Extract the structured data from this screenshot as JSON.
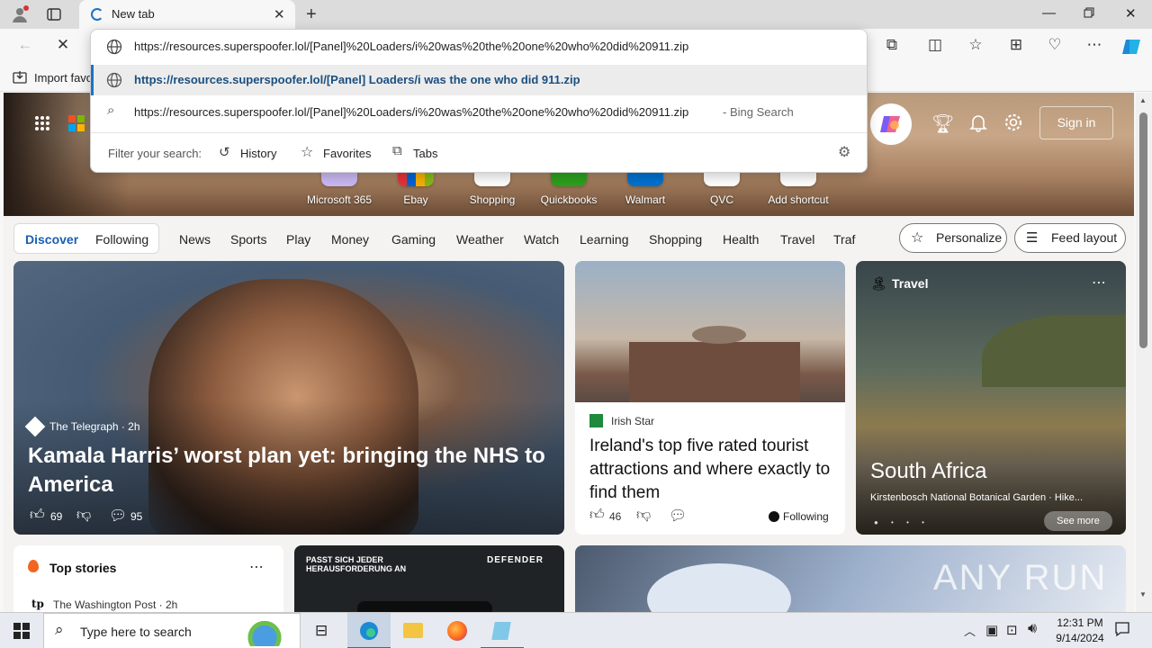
{
  "browser": {
    "tab_title": "New tab",
    "address_value": "https://resources.superspoofer.lol/[Panel]%20Loaders/i%20was%20the%20one%20who%20did%20911.zip",
    "favorites_bar": {
      "import_label": "Import favo"
    }
  },
  "dropdown": {
    "suggestion_url": "https://resources.superspoofer.lol/[Panel] Loaders/i was the one who did 911.zip",
    "search_text": "https://resources.superspoofer.lol/[Panel]%20Loaders/i%20was%20the%20one%20who%20did%20911.zip",
    "search_suffix": "- Bing Search",
    "filter_label": "Filter your search:",
    "filters": [
      "History",
      "Favorites",
      "Tabs"
    ]
  },
  "page": {
    "sign_in": "Sign in",
    "shortcuts": [
      "Microsoft 365",
      "Ebay",
      "Shopping",
      "Quickbooks",
      "Walmart",
      "QVC",
      "Add shortcut"
    ],
    "nav": {
      "discover": "Discover",
      "following": "Following",
      "items": [
        "News",
        "Sports",
        "Play",
        "Money",
        "Gaming",
        "Weather",
        "Watch",
        "Learning",
        "Shopping",
        "Health",
        "Travel",
        "Traf"
      ],
      "personalize": "Personalize",
      "feed_layout": "Feed layout"
    },
    "main_card": {
      "source": "The Telegraph · 2h",
      "headline": "Kamala Harris’ worst plan yet: bringing the NHS to America",
      "likes": "69",
      "comments": "95"
    },
    "mid_card": {
      "source": "Irish Star",
      "headline": "Ireland's top five rated tourist attractions and where exactly to find them",
      "likes": "46",
      "following": "Following"
    },
    "right_card": {
      "category": "Travel",
      "title": "South Africa",
      "subtitle": "Kirstenbosch National Botanical Garden · Hike...",
      "see_more": "See more"
    },
    "top_stories": {
      "title": "Top stories",
      "source": "The Washington Post · 2h"
    },
    "ad_card": {
      "tagline": "PASST SICH JEDER HERAUSFORDERUNG AN",
      "brand": "DEFENDER"
    },
    "watermark": "ANY RUN"
  },
  "taskbar": {
    "search_placeholder": "Type here to search",
    "time": "12:31 PM",
    "date": "9/14/2024"
  }
}
